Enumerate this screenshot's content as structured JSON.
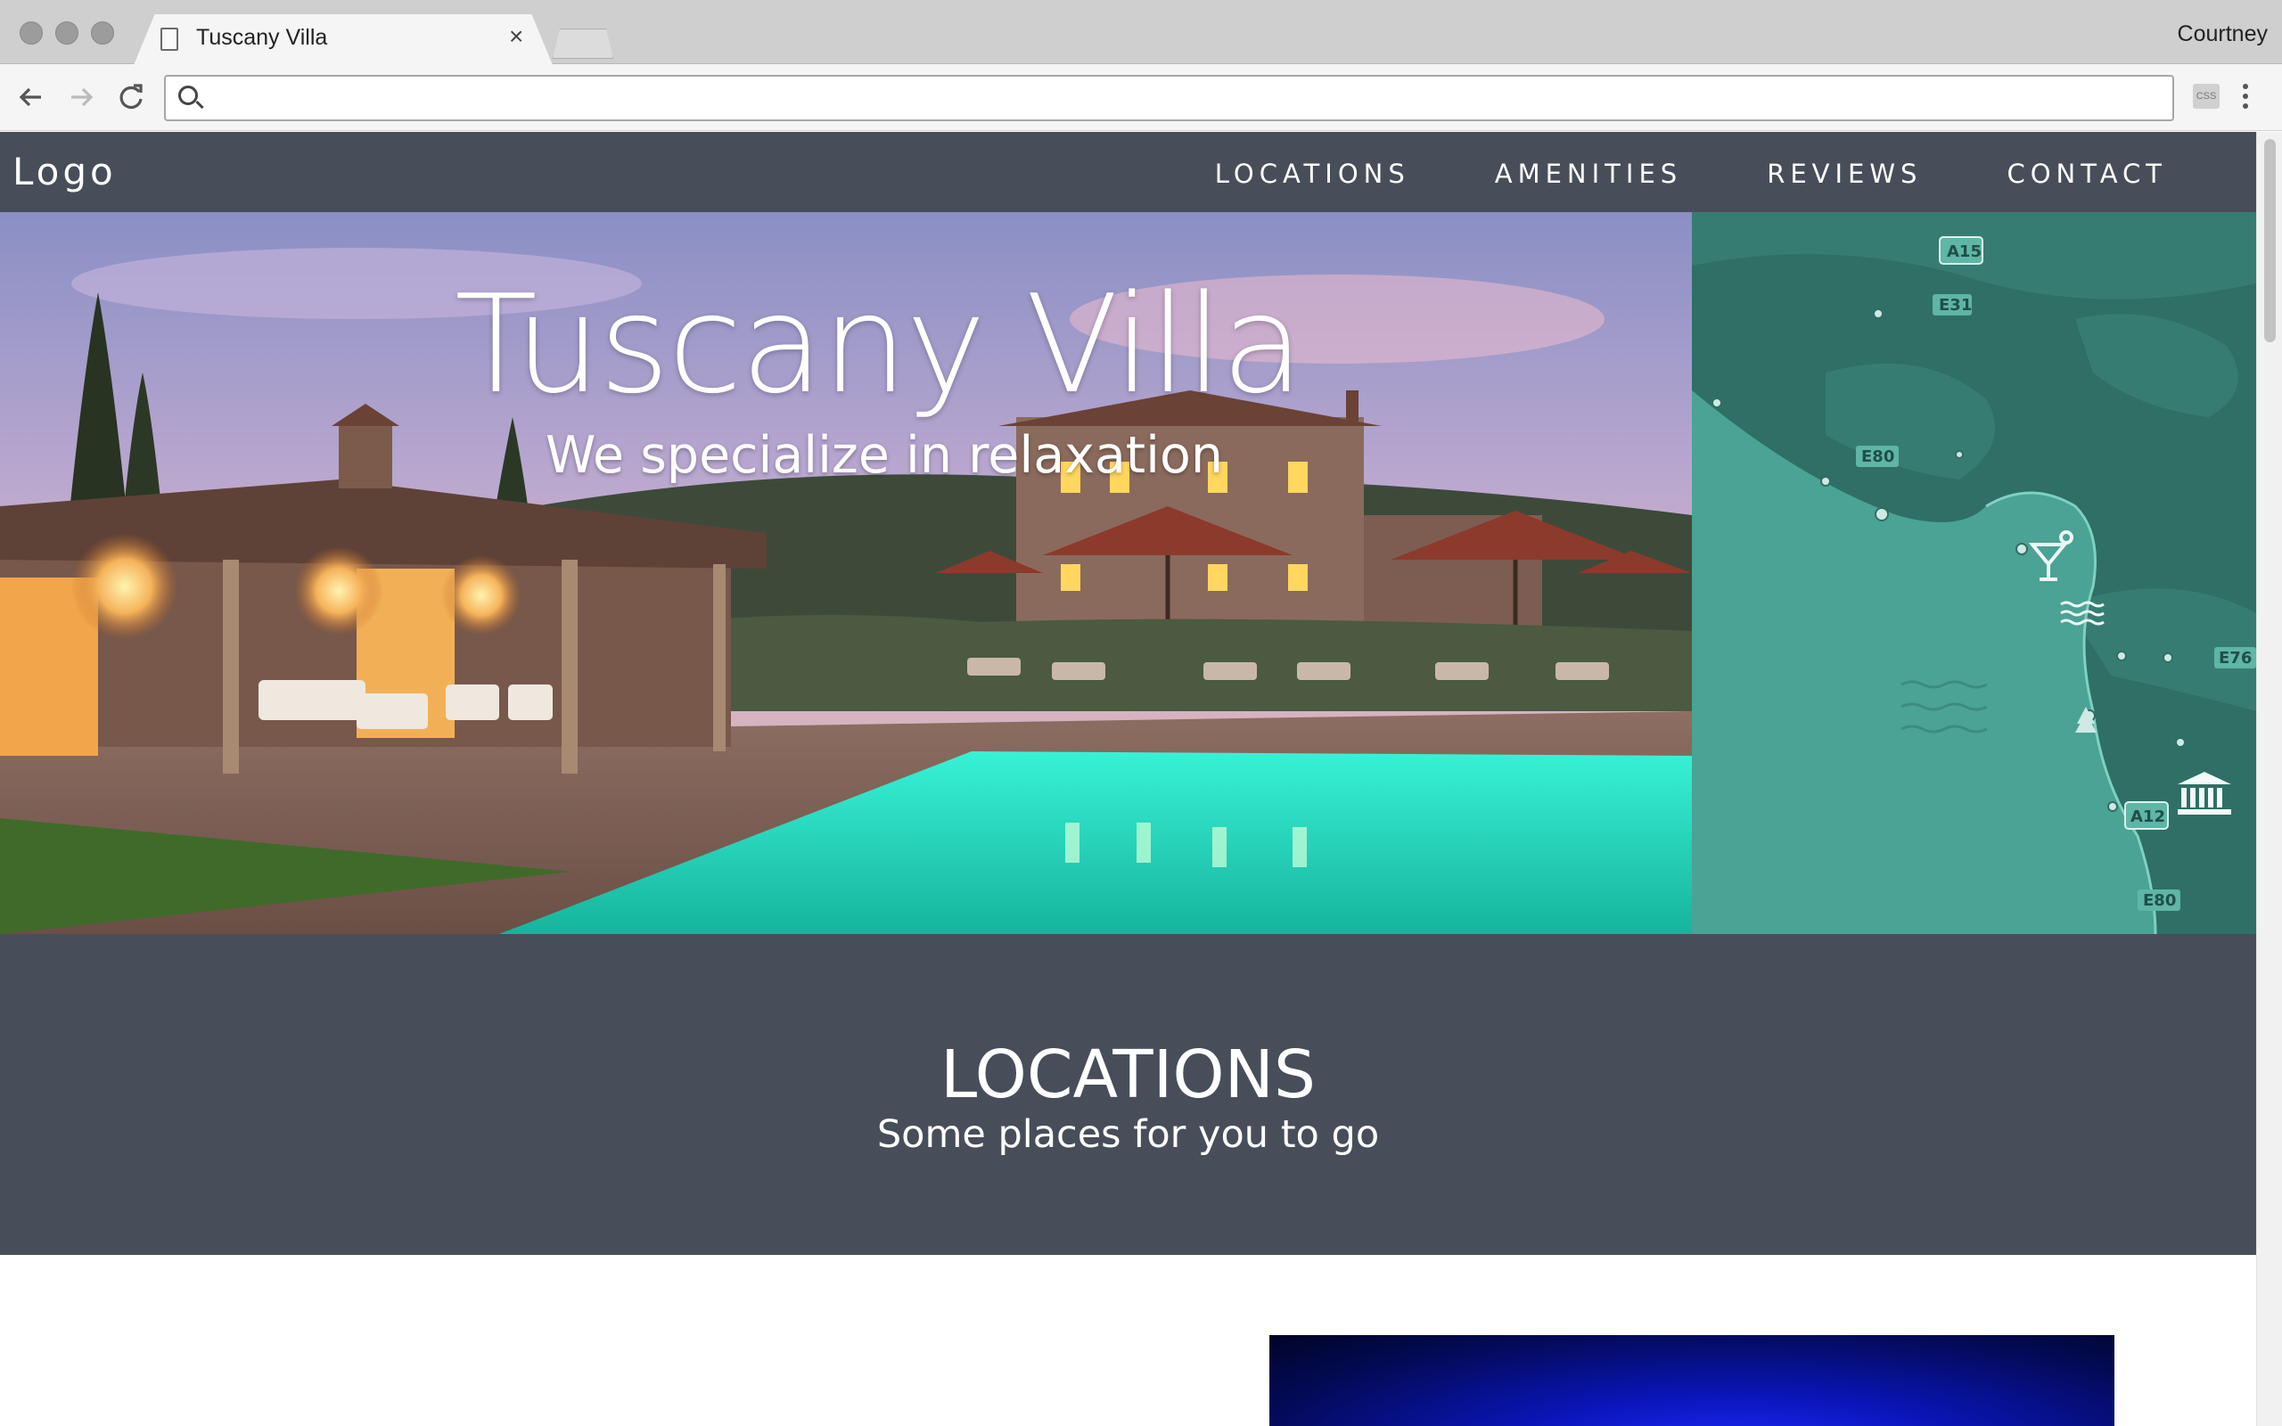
{
  "browser": {
    "tab_title": "Tuscany Villa",
    "tab_close": "×",
    "profile_name": "Courtney",
    "address_value": "",
    "extension_label": "CSS",
    "icons": [
      "page-icon",
      "back-arrow-icon",
      "forward-arrow-icon",
      "reload-icon",
      "search-icon",
      "extension-icon",
      "kebab-menu-icon"
    ]
  },
  "site": {
    "logo": "Logo",
    "nav": [
      "LOCATIONS",
      "AMENITIES",
      "REVIEWS",
      "CONTACT"
    ],
    "hero": {
      "title": "Tuscany Villa",
      "subtitle": "We specialize in relaxation"
    },
    "map_road_labels": [
      "A15",
      "E31",
      "E80",
      "E76",
      "A12",
      "E80"
    ],
    "map_icons": [
      "cocktail-icon",
      "waves-icon",
      "tree-icon",
      "museum-icon"
    ],
    "locations": {
      "title": "LOCATIONS",
      "subtitle": "Some places for you to go"
    }
  },
  "colors": {
    "nav_bg": "#474e5a",
    "map_teal": "#3f9a8c",
    "pool": "#2fe4c8"
  }
}
